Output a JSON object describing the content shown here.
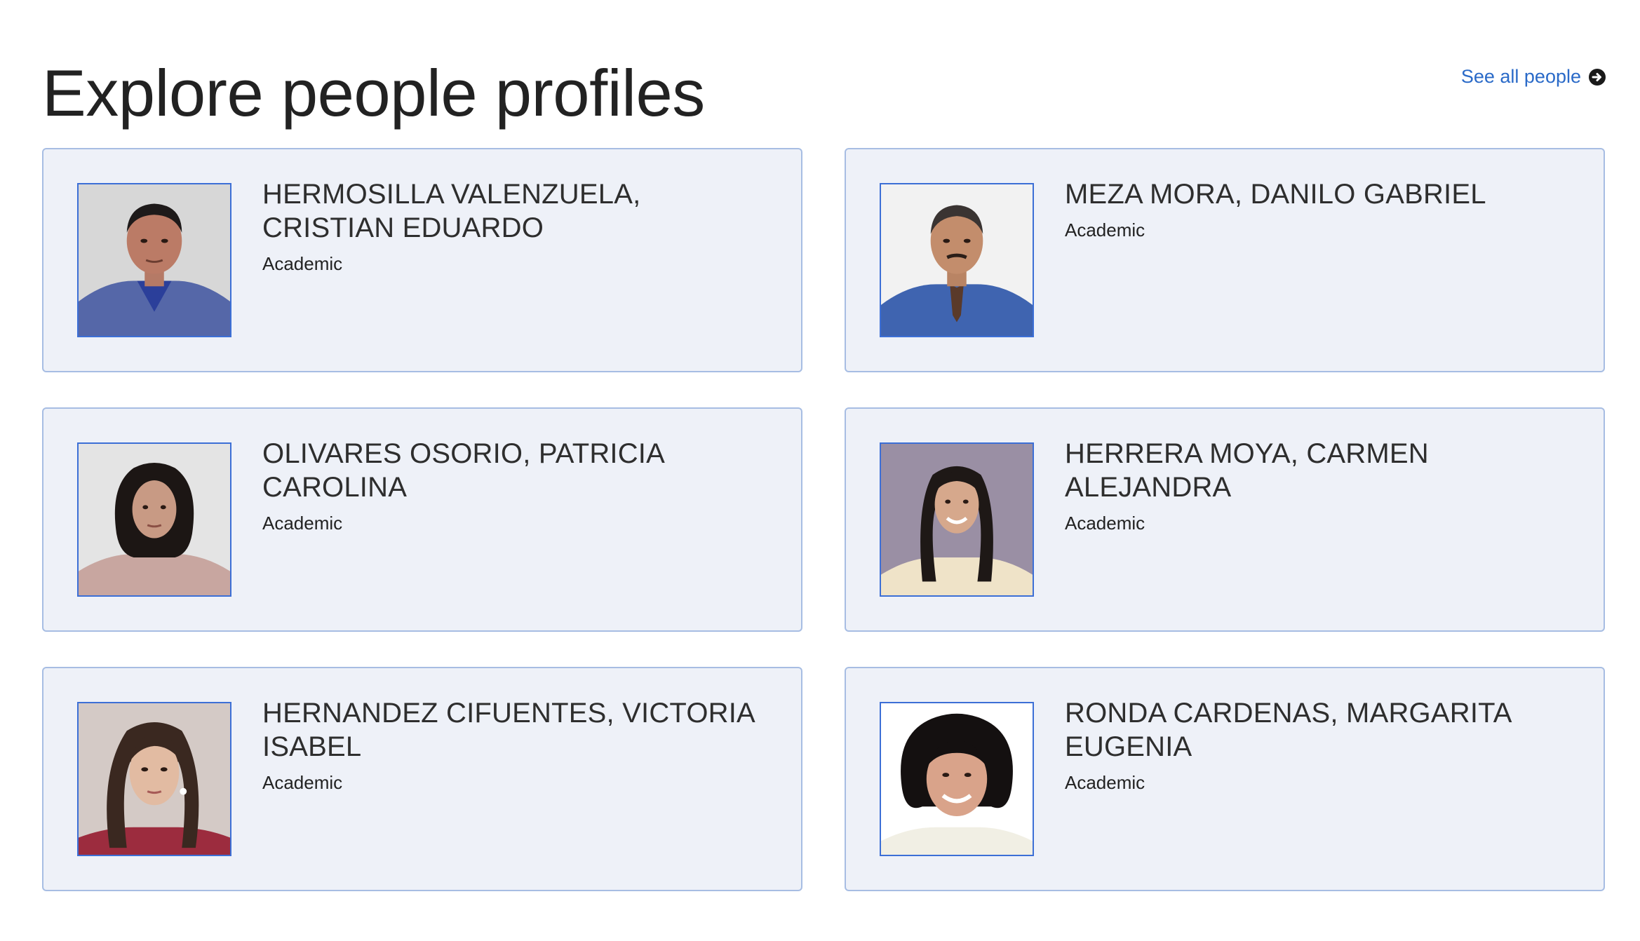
{
  "header": {
    "title": "Explore people profiles",
    "see_all_label": "See all people",
    "see_all_icon": "arrow-circle-right-icon"
  },
  "colors": {
    "link": "#2a6ac8",
    "card_background": "#eef1f8",
    "card_border": "#a7bde3",
    "photo_border": "#3c6fd6"
  },
  "profiles": [
    {
      "name": "HERMOSILLA VALENZUELA, CRISTIAN EDUARDO",
      "role": "Academic",
      "photo_alt": "Profile photo"
    },
    {
      "name": "MEZA MORA, DANILO GABRIEL",
      "role": "Academic",
      "photo_alt": "Profile photo"
    },
    {
      "name": "OLIVARES OSORIO, PATRICIA CAROLINA",
      "role": "Academic",
      "photo_alt": "Profile photo"
    },
    {
      "name": "HERRERA MOYA, CARMEN ALEJANDRA",
      "role": "Academic",
      "photo_alt": "Profile photo"
    },
    {
      "name": "HERNANDEZ CIFUENTES, VICTORIA ISABEL",
      "role": "Academic",
      "photo_alt": "Profile photo"
    },
    {
      "name": "RONDA CARDENAS, MARGARITA EUGENIA",
      "role": "Academic",
      "photo_alt": "Profile photo"
    }
  ]
}
